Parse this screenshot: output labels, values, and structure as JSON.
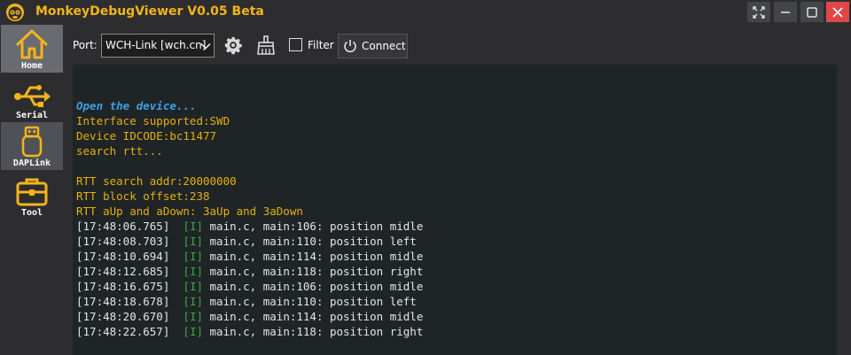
{
  "window": {
    "title": "MonkeyDebugViewer V0.05 Beta",
    "controls": [
      "fullscreen-icon",
      "minimize-icon",
      "maximize-icon",
      "close-icon"
    ]
  },
  "sidebar": {
    "items": [
      {
        "label": "Home",
        "icon": "home-icon",
        "active": true
      },
      {
        "label": "Serial",
        "icon": "usb-icon",
        "active": false
      },
      {
        "label": "DAPLink",
        "icon": "usb-stick-icon",
        "active": false
      },
      {
        "label": "Tool",
        "icon": "toolbox-icon",
        "active": false
      }
    ]
  },
  "toolbar": {
    "port_label": "Port:",
    "port_value": "WCH-Link [wch.cn]",
    "filter_label": "Filter",
    "filter_checked": false,
    "connect_label": "Connect"
  },
  "console": {
    "header_lines": [
      {
        "text": "Open the device...",
        "style": "blue"
      },
      {
        "text": "Interface supported:SWD",
        "style": "yellow"
      },
      {
        "text": "Device IDCODE:bc11477",
        "style": "yellow"
      },
      {
        "text": "search rtt...",
        "style": "yellow"
      },
      {
        "text": "",
        "style": "yellow"
      },
      {
        "text": "RTT search addr:20000000",
        "style": "yellow"
      },
      {
        "text": "RTT block offset:238",
        "style": "yellow"
      },
      {
        "text": "RTT aUp and aDown: 3aUp and 3aDown",
        "style": "yellow"
      }
    ],
    "log_lines": [
      {
        "time": "[17:48:06.765]",
        "level": "[I]",
        "msg": "main.c, main:106: position midle"
      },
      {
        "time": "[17:48:08.703]",
        "level": "[I]",
        "msg": "main.c, main:110: position left"
      },
      {
        "time": "[17:48:10.694]",
        "level": "[I]",
        "msg": "main.c, main:114: position midle"
      },
      {
        "time": "[17:48:12.685]",
        "level": "[I]",
        "msg": "main.c, main:118: position right"
      },
      {
        "time": "[17:48:16.675]",
        "level": "[I]",
        "msg": "main.c, main:106: position midle"
      },
      {
        "time": "[17:48:18.678]",
        "level": "[I]",
        "msg": "main.c, main:110: position left"
      },
      {
        "time": "[17:48:20.670]",
        "level": "[I]",
        "msg": "main.c, main:114: position midle"
      },
      {
        "time": "[17:48:22.657]",
        "level": "[I]",
        "msg": "main.c, main:118: position right"
      }
    ]
  },
  "colors": {
    "accent": "#f2b519",
    "console_bg": "#1f2426",
    "info_blue": "#3e9fe4",
    "log_yellow": "#e5b10f",
    "level_green": "#3fa93f",
    "close_red": "#e04848"
  }
}
